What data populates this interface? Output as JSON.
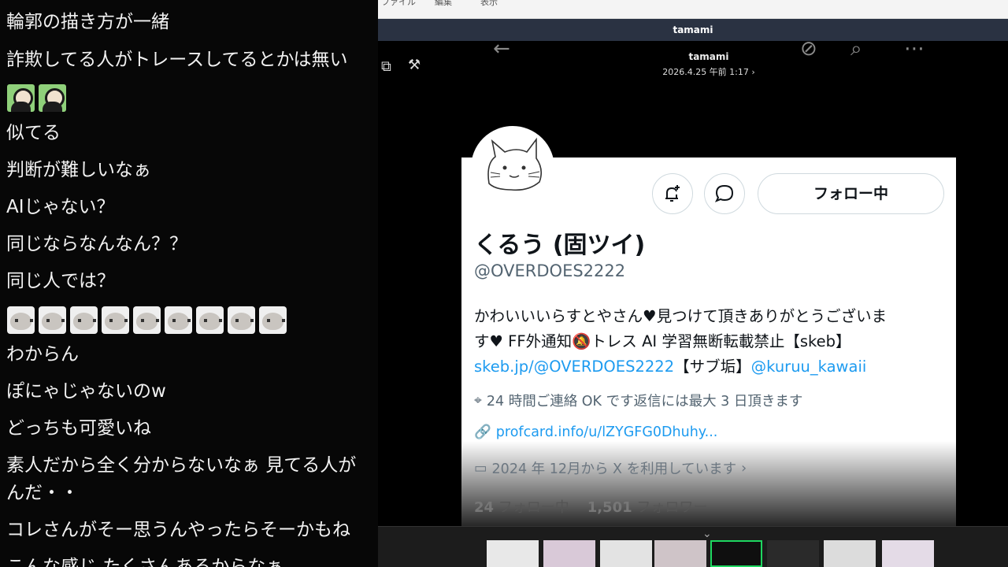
{
  "chat": {
    "messages": [
      "輪郭の描き方が一緒",
      "詐欺してる人がトレースしてるとかは無い",
      "似てる",
      "判断が難しいなぁ",
      "AIじゃない？",
      "同じならなんなん？？",
      "同じ人では？",
      "わからん",
      "ぽにゃじゃないのw",
      "どっちも可愛いね",
      "素人だから全く分からないなぁ 見てる人が",
      "んだ・・",
      "コレさんがそー思うんやったらそーかもね",
      "こんな感じ たくさんあるからなぁ"
    ],
    "emotes": [
      "character-emote",
      "cat-emote"
    ]
  },
  "viewer": {
    "menu": [
      "ファイル",
      "編集",
      "表示"
    ],
    "window_title": "tamami"
  },
  "screenshot": {
    "nav": {
      "name": "tamami",
      "date": "2026.4.25 午前 1:17",
      "date_chevron": "›",
      "icons": [
        "back-arrow-icon",
        "edit-off-icon",
        "search-icon",
        "more-icon"
      ]
    },
    "profile": {
      "display_name": "くるう (固ツイ)",
      "handle": "@OVERDOES2222",
      "follow_label": "フォロー中",
      "bio_line1": "かわいいいらすとやさん♥見つけて頂きありがとうございま",
      "bio_line2": "す♥ FF外通知🔕トレス AI 学習無断転載禁止【skeb】",
      "bio_link1": "skeb.jp/@OVERDOES2222",
      "bio_mid": "【サブ垢】",
      "bio_link2": "@kuruu_kawaii",
      "location": "24 時間ご連絡 OK です返信には最大 3 日頂きます",
      "website": "profcard.info/u/lZYGFG0Dhuhy...",
      "joined": "2024 年 12月から X を利用しています",
      "joined_chevron": "›",
      "following_count": "24",
      "following_label": "フォロー中",
      "followers_count": "1,501",
      "followers_label": "フォロワー"
    },
    "colors": {
      "link": "#1d9bf0",
      "muted": "#536471",
      "text": "#0f1419"
    }
  },
  "thumbnails": {
    "count": 8,
    "active_index": 4,
    "chevron": "⌄"
  }
}
